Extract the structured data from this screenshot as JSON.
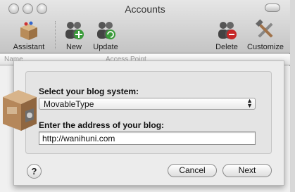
{
  "window": {
    "title": "Accounts"
  },
  "toolbar": {
    "items": [
      {
        "label": "Assistant",
        "icon": "box-icon"
      },
      {
        "label": "New",
        "icon": "people-plus-icon"
      },
      {
        "label": "Update",
        "icon": "people-refresh-icon"
      },
      {
        "label": "Delete",
        "icon": "people-delete-icon"
      },
      {
        "label": "Customize",
        "icon": "tools-icon"
      }
    ]
  },
  "list": {
    "columns": [
      "Name",
      "Access Point"
    ]
  },
  "sheet": {
    "blog_system_label": "Select your blog system:",
    "blog_system_value": "MovableType",
    "address_label": "Enter the address of your blog:",
    "address_value": "http://wanihuni.com",
    "help_label": "?",
    "cancel_label": "Cancel",
    "next_label": "Next"
  }
}
